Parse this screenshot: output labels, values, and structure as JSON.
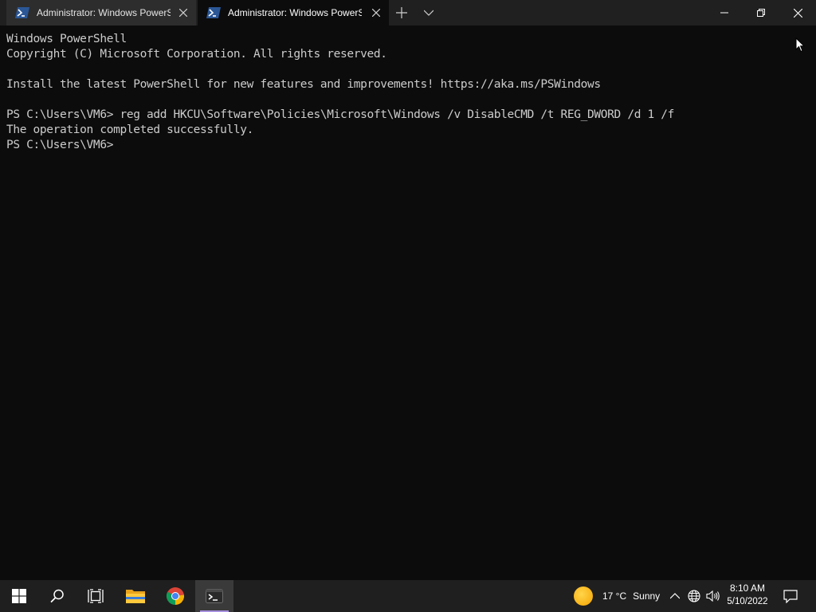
{
  "tabs": [
    {
      "title": "Administrator: Windows PowerS",
      "icon": "powershell-icon",
      "active": false
    },
    {
      "title": "Administrator: Windows PowerS",
      "icon": "powershell-icon",
      "active": true
    }
  ],
  "terminal": {
    "lines": [
      "Windows PowerShell",
      "Copyright (C) Microsoft Corporation. All rights reserved.",
      "",
      "Install the latest PowerShell for new features and improvements! https://aka.ms/PSWindows",
      "",
      "PS C:\\Users\\VM6> reg add HKCU\\Software\\Policies\\Microsoft\\Windows /v DisableCMD /t REG_DWORD /d 1 /f",
      "The operation completed successfully.",
      "PS C:\\Users\\VM6>"
    ]
  },
  "taskbar": {
    "weather": {
      "temp": "17 °C",
      "condition": "Sunny"
    },
    "clock": {
      "time": "8:10 AM",
      "date": "5/10/2022"
    }
  },
  "colors": {
    "terminal_bg": "#0c0c0c",
    "terminal_fg": "#cccccc",
    "titlebar_bg": "#202020",
    "taskbar_bg": "#1f1f1f",
    "accent": "#a58fdc"
  }
}
